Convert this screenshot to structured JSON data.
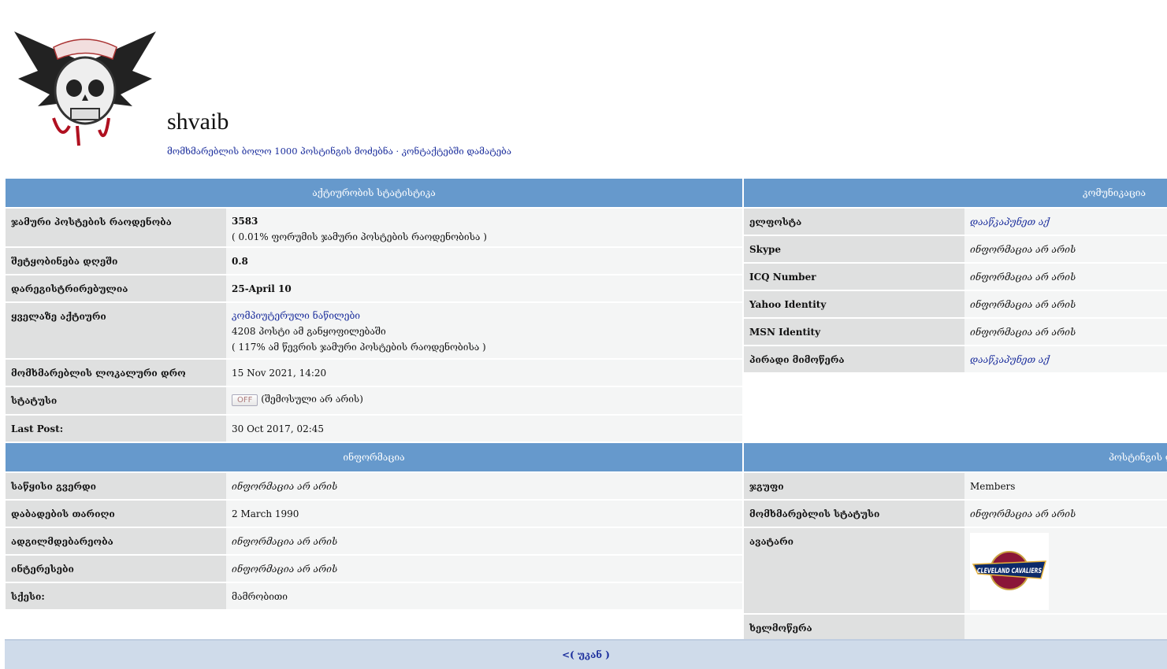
{
  "profile": {
    "username": "shvaib",
    "find_posts_link": "მომხმარებლის ბოლო 1000 პოსტინგის მოძებნა",
    "separator": "·",
    "add_contact_link": "კონტაქტებში დამატება"
  },
  "activity": {
    "title": "აქტიურობის სტატისტიკა",
    "rows": [
      {
        "label": "ჯამური პოსტების რაოდენობა",
        "value": "3583",
        "sub": "( 0.01% ფორუმის ჯამური პოსტების რაოდენობისა )"
      },
      {
        "label": "შეტყობინება დღეში",
        "value": "0.8"
      },
      {
        "label": "დარეგისტრირებულია",
        "value": "25-April 10"
      },
      {
        "label": "ყველაზე აქტიური",
        "forum_link": "კომპიუტერული ნაწილები",
        "line2": "4208 პოსტი ამ განყოფილებაში",
        "line3": "( 117% ამ წევრის ჯამური პოსტების რაოდენობისა )"
      },
      {
        "label": "მომხმარებლის ლოკალური დრო",
        "value": "15 Nov 2021, 14:20"
      },
      {
        "label": "სტატუსი",
        "badge": "OFF",
        "value": "(შემოსული არ არის)"
      },
      {
        "label": "Last Post:",
        "value": "30 Oct 2017, 02:45"
      }
    ]
  },
  "communication": {
    "title": "კომუნიკაცია",
    "rows": [
      {
        "label": "ელფოსტა",
        "value": "დააწკაპუნეთ აქ"
      },
      {
        "label": "Skype",
        "value": "ინფორმაცია არ არის"
      },
      {
        "label": "ICQ Number",
        "value": "ინფორმაცია არ არის"
      },
      {
        "label": "Yahoo Identity",
        "value": "ინფორმაცია არ არის"
      },
      {
        "label": "MSN Identity",
        "value": "ინფორმაცია არ არის"
      },
      {
        "label": "პირადი მიმოწერა",
        "value": "დააწკაპუნეთ აქ"
      }
    ]
  },
  "information": {
    "title": "ინფორმაცია",
    "rows": [
      {
        "label": "საწყისი გვერდი",
        "value": "ინფორმაცია არ არის"
      },
      {
        "label": "დაბადების თარიღი",
        "value": "2 March 1990"
      },
      {
        "label": "ადგილმდებარეობა",
        "value": "ინფორმაცია არ არის"
      },
      {
        "label": "ინტერესები",
        "value": "ინფორმაცია არ არის"
      },
      {
        "label": "სქესი:",
        "value": "მამრობითი"
      }
    ]
  },
  "posting_details": {
    "title": "პოსტინგის დეტალები",
    "rows": [
      {
        "label": "ჯგუფი",
        "value": "Members"
      },
      {
        "label": "მომხმარებლის სტატუსი",
        "value": "ინფორმაცია არ არის"
      },
      {
        "label": "ავატარი",
        "avatar_text": "CLEVELAND CAVALIERS"
      },
      {
        "label": "ხელმოწერა",
        "value": ""
      }
    ]
  },
  "footer": {
    "back_link": "<( უკან )"
  },
  "colors": {
    "header": "#6699cc",
    "label_bg": "#dfe0e0",
    "value_bg": "#f4f5f5",
    "link": "#1a2d9c",
    "footer_bg": "#cfdbea"
  }
}
